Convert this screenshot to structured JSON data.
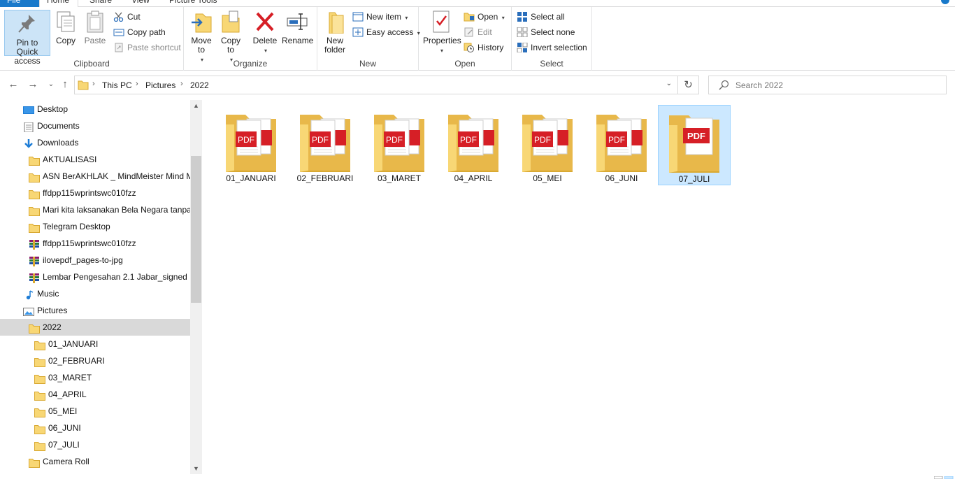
{
  "ribbon_tabs": [
    "File",
    "Home",
    "Share",
    "View",
    "Picture Tools"
  ],
  "ribbon": {
    "clipboard": {
      "label": "Clipboard",
      "pin": "Pin to Quick access",
      "copy": "Copy",
      "paste": "Paste",
      "cut": "Cut",
      "copy_path": "Copy path",
      "paste_shortcut": "Paste shortcut"
    },
    "organize": {
      "label": "Organize",
      "move_to": "Move to",
      "copy_to": "Copy to",
      "delete": "Delete",
      "rename": "Rename"
    },
    "new": {
      "label": "New",
      "new_folder": "New folder",
      "new_item": "New item",
      "easy_access": "Easy access"
    },
    "open": {
      "label": "Open",
      "properties": "Properties",
      "open": "Open",
      "edit": "Edit",
      "history": "History"
    },
    "select": {
      "label": "Select",
      "select_all": "Select all",
      "select_none": "Select none",
      "invert_selection": "Invert selection"
    }
  },
  "address": {
    "crumbs": [
      "This PC",
      "Pictures",
      "2022"
    ]
  },
  "search": {
    "placeholder": "Search 2022"
  },
  "nav": [
    {
      "label": "Desktop",
      "icon": "desktop-icon"
    },
    {
      "label": "Documents",
      "icon": "documents-icon"
    },
    {
      "label": "Downloads",
      "icon": "downloads-icon"
    },
    {
      "label": "AKTUALISASI",
      "icon": "folder-icon"
    },
    {
      "label": "ASN BerAKHLAK _ MindMeister Mind M",
      "icon": "folder-icon"
    },
    {
      "label": "ffdpp115wprintswc010fzz",
      "icon": "folder-icon"
    },
    {
      "label": "Mari kita laksanakan Bela Negara tanpa I",
      "icon": "folder-icon"
    },
    {
      "label": "Telegram Desktop",
      "icon": "folder-icon"
    },
    {
      "label": "ffdpp115wprintswc010fzz",
      "icon": "archive-icon"
    },
    {
      "label": "ilovepdf_pages-to-jpg",
      "icon": "archive-icon"
    },
    {
      "label": "Lembar Pengesahan 2.1 Jabar_signed",
      "icon": "archive-icon"
    },
    {
      "label": "Music",
      "icon": "music-icon"
    },
    {
      "label": "Pictures",
      "icon": "pictures-icon"
    },
    {
      "label": "2022",
      "icon": "folder-icon"
    },
    {
      "label": "01_JANUARI",
      "icon": "folder-icon"
    },
    {
      "label": "02_FEBRUARI",
      "icon": "folder-icon"
    },
    {
      "label": "03_MARET",
      "icon": "folder-icon"
    },
    {
      "label": "04_APRIL",
      "icon": "folder-icon"
    },
    {
      "label": "05_MEI",
      "icon": "folder-icon"
    },
    {
      "label": "06_JUNI",
      "icon": "folder-icon"
    },
    {
      "label": "07_JULI",
      "icon": "folder-icon"
    },
    {
      "label": "Camera Roll",
      "icon": "folder-icon"
    }
  ],
  "folders": [
    {
      "name": "01_JANUARI"
    },
    {
      "name": "02_FEBRUARI"
    },
    {
      "name": "03_MARET"
    },
    {
      "name": "04_APRIL"
    },
    {
      "name": "05_MEI"
    },
    {
      "name": "06_JUNI"
    },
    {
      "name": "07_JULI"
    }
  ],
  "pdf_label": "PDF",
  "colors": {
    "accent": "#1979ca",
    "selection": "#cce8ff",
    "folder": "#f8d775",
    "pdf_red": "#d61f26"
  }
}
